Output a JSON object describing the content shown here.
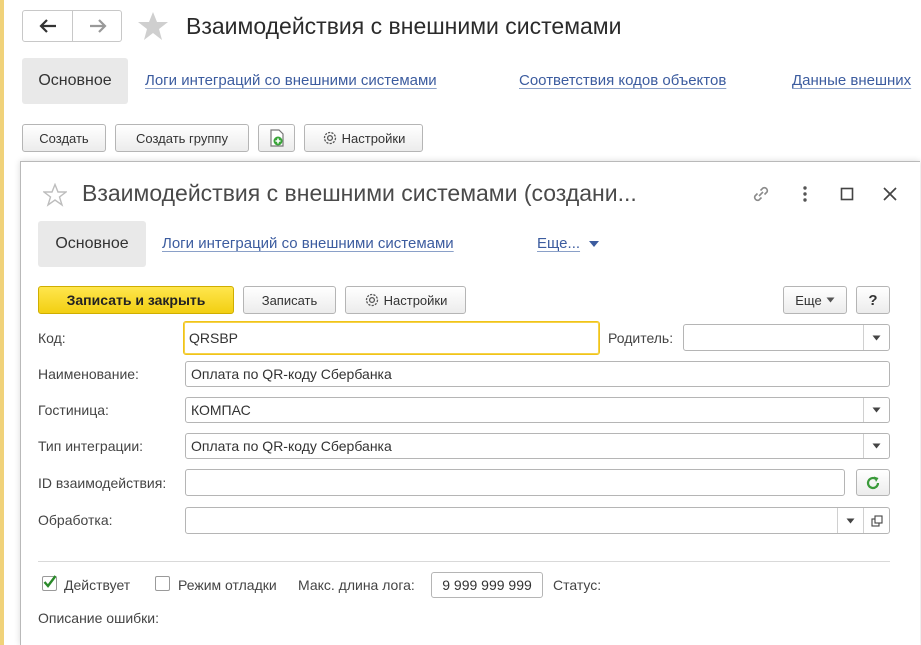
{
  "window": {
    "title": "Взаимодействия с внешними системами"
  },
  "main_tabs": {
    "active": "Основное",
    "links": [
      "Логи интеграций со внешними системами",
      "Соответствия кодов объектов",
      "Данные внешних"
    ]
  },
  "toolbar": {
    "create": "Создать",
    "create_group": "Создать группу",
    "settings": "Настройки"
  },
  "form": {
    "title": "Взаимодействия с внешними системами (создани...",
    "tabs": {
      "active": "Основное",
      "link": "Логи интеграций со внешними системами",
      "more": "Еще..."
    },
    "buttons": {
      "save_close": "Записать и закрыть",
      "save": "Записать",
      "settings": "Настройки",
      "more": "Еще",
      "help": "?"
    },
    "fields": {
      "code_label": "Код:",
      "code_value": "QRSBP",
      "parent_label": "Родитель:",
      "parent_value": "",
      "name_label": "Наименование:",
      "name_value": "Оплата по QR-коду Сбербанка",
      "hotel_label": "Гостиница:",
      "hotel_value": "КОМПАС",
      "type_label": "Тип интеграции:",
      "type_value": "Оплата по QR-коду Сбербанка",
      "id_label": "ID взаимодействия:",
      "id_value": "",
      "processing_label": "Обработка:",
      "processing_value": ""
    },
    "bottom": {
      "active_label": "Действует",
      "active_checked": true,
      "debug_label": "Режим отладки",
      "debug_checked": false,
      "maxlog_label": "Макс. длина лога:",
      "maxlog_value": "9 999 999 999",
      "status_label": "Статус:",
      "error_label": "Описание ошибки:"
    }
  },
  "colors": {
    "accent_yellow": "#f2cf12",
    "link_blue": "#3c5c9f",
    "refresh_green": "#3a9a3a"
  }
}
